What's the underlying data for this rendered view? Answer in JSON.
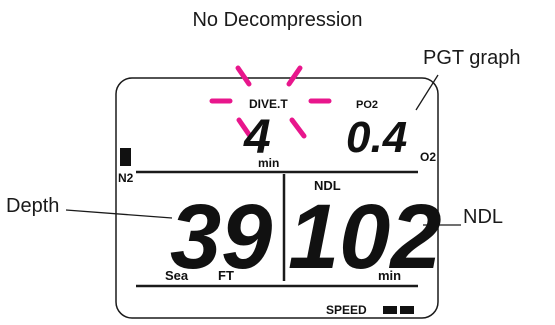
{
  "title": "No Decompression",
  "callouts": {
    "pgt_graph": "PGT graph",
    "depth": "Depth",
    "ndl": "NDL"
  },
  "display": {
    "dive_time_label": "DIVE.T",
    "dive_time_value": "4",
    "dive_time_unit": "min",
    "po2_label": "PO2",
    "po2_value": "0.4",
    "o2_label": "O2",
    "n2_label": "N2",
    "depth_value": "39",
    "depth_mode": "Sea",
    "depth_unit": "FT",
    "ndl_label": "NDL",
    "ndl_value": "102",
    "ndl_unit": "min",
    "speed_label": "SPEED"
  },
  "colors": {
    "blink_marks": "#e8168c",
    "segments": "#111111"
  }
}
